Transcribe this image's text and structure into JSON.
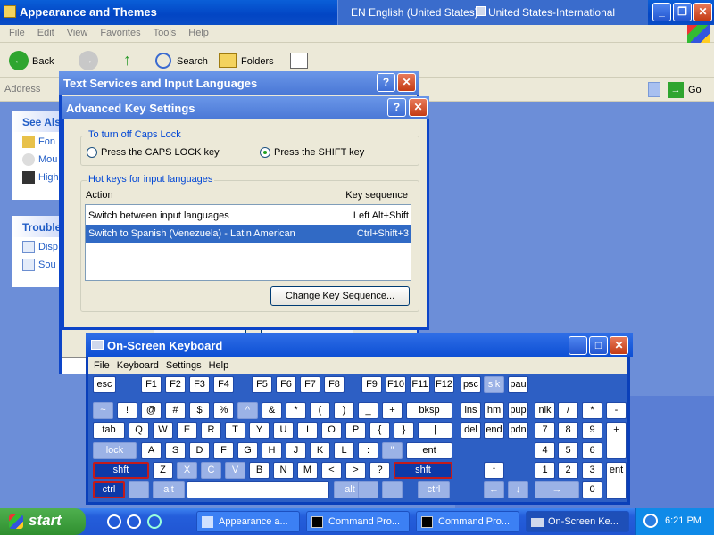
{
  "explorer": {
    "title": "Appearance and Themes",
    "input_language": "EN English (United States)",
    "keyboard_layout": "United States-International",
    "menu": [
      "File",
      "Edit",
      "View",
      "Favorites",
      "Tools",
      "Help"
    ],
    "toolbar": {
      "back": "Back",
      "search": "Search",
      "folders": "Folders"
    },
    "address_label": "Address",
    "go_label": "Go",
    "see_also": {
      "title": "See Als",
      "items": [
        "Fon",
        "Mou",
        "High"
      ]
    },
    "troubleshooters": {
      "title": "Trouble",
      "items": [
        "Disp",
        "Sou"
      ]
    }
  },
  "text_services_dialog": {
    "title": "Text Services and Input Languages"
  },
  "advanced_key_dialog": {
    "title": "Advanced Key Settings",
    "caps_group": "To turn off Caps Lock",
    "caps_option1": "Press the CAPS LOCK key",
    "caps_option2": "Press the SHIFT key",
    "caps_selected": "shift",
    "hotkeys_group": "Hot keys for input languages",
    "col_action": "Action",
    "col_keyseq": "Key sequence",
    "rows": [
      {
        "action": "Switch between input languages",
        "seq": "Left Alt+Shift",
        "selected": false
      },
      {
        "action": "Switch to Spanish (Venezuela) - Latin American",
        "seq": "Ctrl+Shift+3",
        "selected": true
      }
    ],
    "change_button": "Change Key Sequence..."
  },
  "osk": {
    "title": "On-Screen Keyboard",
    "menu": [
      "File",
      "Keyboard",
      "Settings",
      "Help"
    ],
    "rows": [
      [
        "esc",
        "F1",
        "F2",
        "F3",
        "F4",
        "F5",
        "F6",
        "F7",
        "F8",
        "F9",
        "F10",
        "F11",
        "F12",
        "psc",
        "slk",
        "pau"
      ],
      [
        "~",
        "!",
        "@",
        "#",
        "$",
        "%",
        "^",
        "&",
        "*",
        "(",
        ")",
        "_",
        "+",
        "bksp",
        "ins",
        "hm",
        "pup",
        "nlk",
        "/",
        "*",
        "-"
      ],
      [
        "tab",
        "Q",
        "W",
        "E",
        "R",
        "T",
        "Y",
        "U",
        "I",
        "O",
        "P",
        "{",
        "}",
        "|",
        "del",
        "end",
        "pdn",
        "7",
        "8",
        "9",
        "+"
      ],
      [
        "lock",
        "A",
        "S",
        "D",
        "F",
        "G",
        "H",
        "J",
        "K",
        "L",
        ":",
        "\"",
        "ent",
        "4",
        "5",
        "6"
      ],
      [
        "shft",
        "Z",
        "X",
        "C",
        "V",
        "B",
        "N",
        "M",
        "<",
        ">",
        "?",
        "shft",
        "↑",
        "1",
        "2",
        "3",
        "ent"
      ],
      [
        "ctrl",
        "alt",
        "alt",
        "ctrl",
        "←",
        "↓",
        "→",
        "0",
        "."
      ]
    ]
  },
  "taskbar": {
    "start": "start",
    "buttons": [
      "Appearance a...",
      "Command Pro...",
      "Command Pro...",
      "On-Screen Ke..."
    ],
    "time": "6:21 PM"
  }
}
